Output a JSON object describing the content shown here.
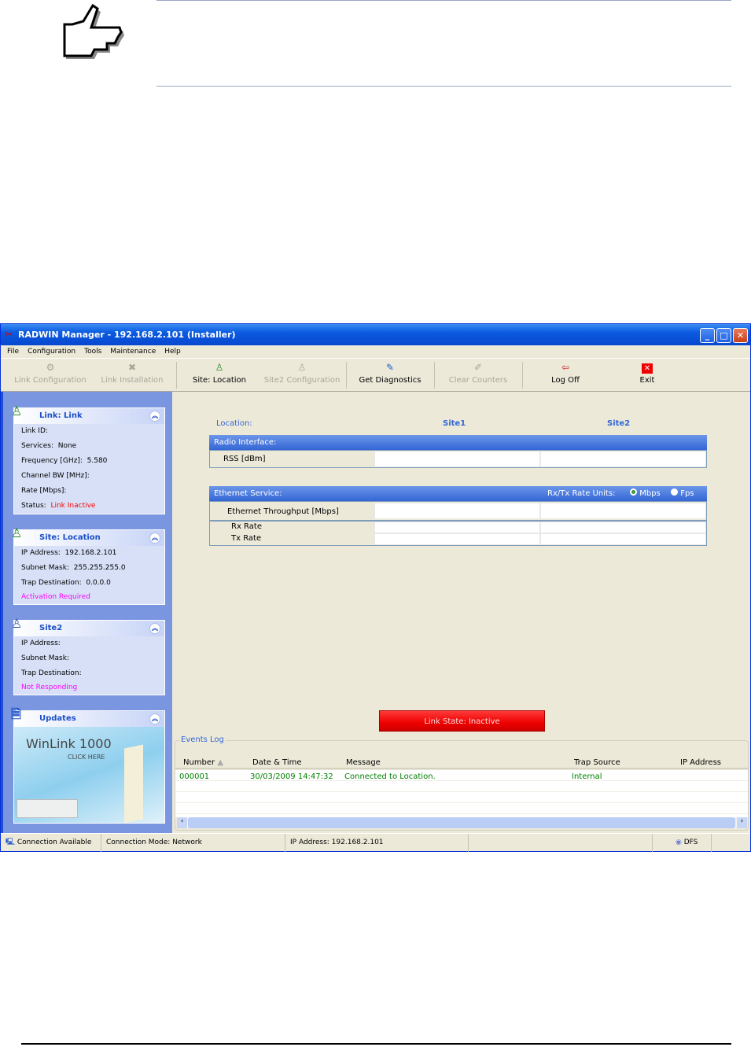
{
  "window": {
    "title": "RADWIN Manager - 192.168.2.101 (Installer)",
    "minimize": "_",
    "maximize": "□",
    "close": "✕"
  },
  "menu": [
    "File",
    "Configuration",
    "Tools",
    "Maintenance",
    "Help"
  ],
  "toolbar": [
    {
      "label": "Link Configuration",
      "icon": "gear-icon",
      "enabled": false
    },
    {
      "label": "Link Installation",
      "icon": "tools-icon",
      "enabled": false
    },
    {
      "label": "Site: Location",
      "icon": "antenna-icon",
      "enabled": true
    },
    {
      "label": "Site2 Configuration",
      "icon": "antenna-icon",
      "enabled": false
    },
    {
      "label": "Get Diagnostics",
      "icon": "diagnostics-icon",
      "enabled": true
    },
    {
      "label": "Clear Counters",
      "icon": "eraser-icon",
      "enabled": false
    },
    {
      "label": "Log Off",
      "icon": "log-off-icon",
      "enabled": true
    },
    {
      "label": "Exit",
      "icon": "exit-icon",
      "enabled": true
    }
  ],
  "sidebar": {
    "link": {
      "title": "Link: Link",
      "rows": [
        {
          "label": "Link ID:",
          "value": ""
        },
        {
          "label": "Services:",
          "value": "None"
        },
        {
          "label": "Frequency [GHz]:",
          "value": "5.580"
        },
        {
          "label": "Channel BW [MHz]:",
          "value": ""
        },
        {
          "label": "Rate [Mbps]:",
          "value": ""
        },
        {
          "label": "Status:",
          "value": "Link Inactive"
        }
      ]
    },
    "site": {
      "title": "Site: Location",
      "rows": [
        {
          "label": "IP Address:",
          "value": "192.168.2.101"
        },
        {
          "label": "Subnet Mask:",
          "value": "255.255.255.0"
        },
        {
          "label": "Trap Destination:",
          "value": "0.0.0.0"
        }
      ],
      "status": "Activation Required"
    },
    "site2": {
      "title": "Site2",
      "rows": [
        {
          "label": "IP Address:",
          "value": ""
        },
        {
          "label": "Subnet Mask:",
          "value": ""
        },
        {
          "label": "Trap Destination:",
          "value": ""
        }
      ],
      "status": "Not Responding"
    },
    "updates": {
      "title": "Updates",
      "banner": "WinLink 1000",
      "banner_sub": "CLICK HERE"
    }
  },
  "main": {
    "location_label": "Location:",
    "site1": "Site1",
    "site2": "Site2",
    "radio_header": "Radio Interface:",
    "rss_label": "RSS [dBm]",
    "eth_header": "Ethernet Service:",
    "rate_units_label": "Rx/Tx Rate Units:",
    "unit_mbps": "Mbps",
    "unit_fps": "Fps",
    "selected_unit": "Mbps",
    "throughput_label": "Ethernet Throughput [Mbps]",
    "rx_label": "Rx Rate",
    "tx_label": "Tx Rate",
    "link_state": "Link State: Inactive"
  },
  "events": {
    "title": "Events Log",
    "columns": [
      "Number",
      "Date & Time",
      "Message",
      "Trap Source",
      "IP Address"
    ],
    "rows": [
      [
        "000001",
        "30/03/2009 14:47:32",
        "Connected to Location.",
        "Internal",
        ""
      ]
    ]
  },
  "status": {
    "connection": "Connection Available",
    "mode": "Connection Mode: Network",
    "ip": "IP Address: 192.168.2.101",
    "dfs": "DFS"
  },
  "colors": {
    "accent": "#3366d6",
    "error": "#ff0000",
    "warning": "#ff00ff",
    "ok": "#008000",
    "link_state_bg": "#ee1111"
  }
}
